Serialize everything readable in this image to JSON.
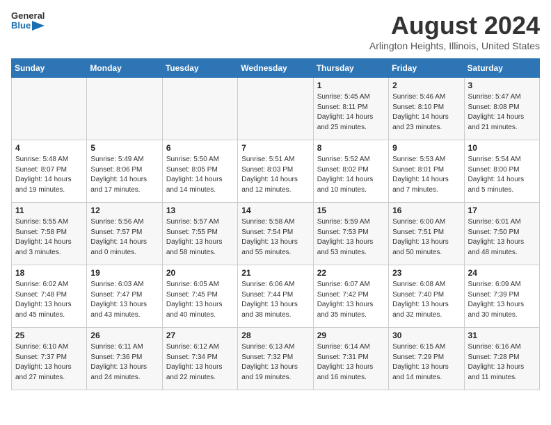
{
  "logo": {
    "line1": "General",
    "line2": "Blue"
  },
  "title": "August 2024",
  "subtitle": "Arlington Heights, Illinois, United States",
  "days_of_week": [
    "Sunday",
    "Monday",
    "Tuesday",
    "Wednesday",
    "Thursday",
    "Friday",
    "Saturday"
  ],
  "weeks": [
    [
      {
        "day": "",
        "info": ""
      },
      {
        "day": "",
        "info": ""
      },
      {
        "day": "",
        "info": ""
      },
      {
        "day": "",
        "info": ""
      },
      {
        "day": "1",
        "info": "Sunrise: 5:45 AM\nSunset: 8:11 PM\nDaylight: 14 hours\nand 25 minutes."
      },
      {
        "day": "2",
        "info": "Sunrise: 5:46 AM\nSunset: 8:10 PM\nDaylight: 14 hours\nand 23 minutes."
      },
      {
        "day": "3",
        "info": "Sunrise: 5:47 AM\nSunset: 8:08 PM\nDaylight: 14 hours\nand 21 minutes."
      }
    ],
    [
      {
        "day": "4",
        "info": "Sunrise: 5:48 AM\nSunset: 8:07 PM\nDaylight: 14 hours\nand 19 minutes."
      },
      {
        "day": "5",
        "info": "Sunrise: 5:49 AM\nSunset: 8:06 PM\nDaylight: 14 hours\nand 17 minutes."
      },
      {
        "day": "6",
        "info": "Sunrise: 5:50 AM\nSunset: 8:05 PM\nDaylight: 14 hours\nand 14 minutes."
      },
      {
        "day": "7",
        "info": "Sunrise: 5:51 AM\nSunset: 8:03 PM\nDaylight: 14 hours\nand 12 minutes."
      },
      {
        "day": "8",
        "info": "Sunrise: 5:52 AM\nSunset: 8:02 PM\nDaylight: 14 hours\nand 10 minutes."
      },
      {
        "day": "9",
        "info": "Sunrise: 5:53 AM\nSunset: 8:01 PM\nDaylight: 14 hours\nand 7 minutes."
      },
      {
        "day": "10",
        "info": "Sunrise: 5:54 AM\nSunset: 8:00 PM\nDaylight: 14 hours\nand 5 minutes."
      }
    ],
    [
      {
        "day": "11",
        "info": "Sunrise: 5:55 AM\nSunset: 7:58 PM\nDaylight: 14 hours\nand 3 minutes."
      },
      {
        "day": "12",
        "info": "Sunrise: 5:56 AM\nSunset: 7:57 PM\nDaylight: 14 hours\nand 0 minutes."
      },
      {
        "day": "13",
        "info": "Sunrise: 5:57 AM\nSunset: 7:55 PM\nDaylight: 13 hours\nand 58 minutes."
      },
      {
        "day": "14",
        "info": "Sunrise: 5:58 AM\nSunset: 7:54 PM\nDaylight: 13 hours\nand 55 minutes."
      },
      {
        "day": "15",
        "info": "Sunrise: 5:59 AM\nSunset: 7:53 PM\nDaylight: 13 hours\nand 53 minutes."
      },
      {
        "day": "16",
        "info": "Sunrise: 6:00 AM\nSunset: 7:51 PM\nDaylight: 13 hours\nand 50 minutes."
      },
      {
        "day": "17",
        "info": "Sunrise: 6:01 AM\nSunset: 7:50 PM\nDaylight: 13 hours\nand 48 minutes."
      }
    ],
    [
      {
        "day": "18",
        "info": "Sunrise: 6:02 AM\nSunset: 7:48 PM\nDaylight: 13 hours\nand 45 minutes."
      },
      {
        "day": "19",
        "info": "Sunrise: 6:03 AM\nSunset: 7:47 PM\nDaylight: 13 hours\nand 43 minutes."
      },
      {
        "day": "20",
        "info": "Sunrise: 6:05 AM\nSunset: 7:45 PM\nDaylight: 13 hours\nand 40 minutes."
      },
      {
        "day": "21",
        "info": "Sunrise: 6:06 AM\nSunset: 7:44 PM\nDaylight: 13 hours\nand 38 minutes."
      },
      {
        "day": "22",
        "info": "Sunrise: 6:07 AM\nSunset: 7:42 PM\nDaylight: 13 hours\nand 35 minutes."
      },
      {
        "day": "23",
        "info": "Sunrise: 6:08 AM\nSunset: 7:40 PM\nDaylight: 13 hours\nand 32 minutes."
      },
      {
        "day": "24",
        "info": "Sunrise: 6:09 AM\nSunset: 7:39 PM\nDaylight: 13 hours\nand 30 minutes."
      }
    ],
    [
      {
        "day": "25",
        "info": "Sunrise: 6:10 AM\nSunset: 7:37 PM\nDaylight: 13 hours\nand 27 minutes."
      },
      {
        "day": "26",
        "info": "Sunrise: 6:11 AM\nSunset: 7:36 PM\nDaylight: 13 hours\nand 24 minutes."
      },
      {
        "day": "27",
        "info": "Sunrise: 6:12 AM\nSunset: 7:34 PM\nDaylight: 13 hours\nand 22 minutes."
      },
      {
        "day": "28",
        "info": "Sunrise: 6:13 AM\nSunset: 7:32 PM\nDaylight: 13 hours\nand 19 minutes."
      },
      {
        "day": "29",
        "info": "Sunrise: 6:14 AM\nSunset: 7:31 PM\nDaylight: 13 hours\nand 16 minutes."
      },
      {
        "day": "30",
        "info": "Sunrise: 6:15 AM\nSunset: 7:29 PM\nDaylight: 13 hours\nand 14 minutes."
      },
      {
        "day": "31",
        "info": "Sunrise: 6:16 AM\nSunset: 7:28 PM\nDaylight: 13 hours\nand 11 minutes."
      }
    ]
  ]
}
